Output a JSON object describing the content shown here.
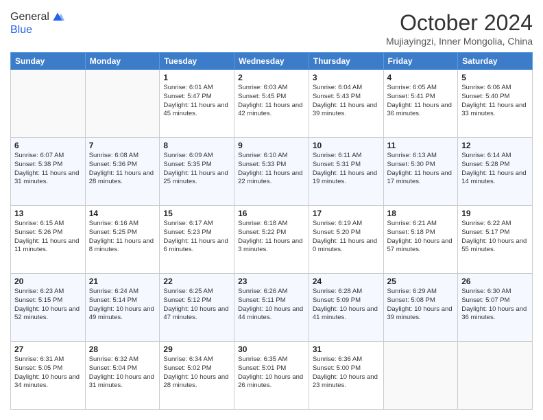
{
  "header": {
    "logo_line1": "General",
    "logo_line2": "Blue",
    "title": "October 2024",
    "subtitle": "Mujiayingzi, Inner Mongolia, China"
  },
  "weekdays": [
    "Sunday",
    "Monday",
    "Tuesday",
    "Wednesday",
    "Thursday",
    "Friday",
    "Saturday"
  ],
  "weeks": [
    [
      {
        "day": "",
        "info": ""
      },
      {
        "day": "",
        "info": ""
      },
      {
        "day": "1",
        "info": "Sunrise: 6:01 AM\nSunset: 5:47 PM\nDaylight: 11 hours and 45 minutes."
      },
      {
        "day": "2",
        "info": "Sunrise: 6:03 AM\nSunset: 5:45 PM\nDaylight: 11 hours and 42 minutes."
      },
      {
        "day": "3",
        "info": "Sunrise: 6:04 AM\nSunset: 5:43 PM\nDaylight: 11 hours and 39 minutes."
      },
      {
        "day": "4",
        "info": "Sunrise: 6:05 AM\nSunset: 5:41 PM\nDaylight: 11 hours and 36 minutes."
      },
      {
        "day": "5",
        "info": "Sunrise: 6:06 AM\nSunset: 5:40 PM\nDaylight: 11 hours and 33 minutes."
      }
    ],
    [
      {
        "day": "6",
        "info": "Sunrise: 6:07 AM\nSunset: 5:38 PM\nDaylight: 11 hours and 31 minutes."
      },
      {
        "day": "7",
        "info": "Sunrise: 6:08 AM\nSunset: 5:36 PM\nDaylight: 11 hours and 28 minutes."
      },
      {
        "day": "8",
        "info": "Sunrise: 6:09 AM\nSunset: 5:35 PM\nDaylight: 11 hours and 25 minutes."
      },
      {
        "day": "9",
        "info": "Sunrise: 6:10 AM\nSunset: 5:33 PM\nDaylight: 11 hours and 22 minutes."
      },
      {
        "day": "10",
        "info": "Sunrise: 6:11 AM\nSunset: 5:31 PM\nDaylight: 11 hours and 19 minutes."
      },
      {
        "day": "11",
        "info": "Sunrise: 6:13 AM\nSunset: 5:30 PM\nDaylight: 11 hours and 17 minutes."
      },
      {
        "day": "12",
        "info": "Sunrise: 6:14 AM\nSunset: 5:28 PM\nDaylight: 11 hours and 14 minutes."
      }
    ],
    [
      {
        "day": "13",
        "info": "Sunrise: 6:15 AM\nSunset: 5:26 PM\nDaylight: 11 hours and 11 minutes."
      },
      {
        "day": "14",
        "info": "Sunrise: 6:16 AM\nSunset: 5:25 PM\nDaylight: 11 hours and 8 minutes."
      },
      {
        "day": "15",
        "info": "Sunrise: 6:17 AM\nSunset: 5:23 PM\nDaylight: 11 hours and 6 minutes."
      },
      {
        "day": "16",
        "info": "Sunrise: 6:18 AM\nSunset: 5:22 PM\nDaylight: 11 hours and 3 minutes."
      },
      {
        "day": "17",
        "info": "Sunrise: 6:19 AM\nSunset: 5:20 PM\nDaylight: 11 hours and 0 minutes."
      },
      {
        "day": "18",
        "info": "Sunrise: 6:21 AM\nSunset: 5:18 PM\nDaylight: 10 hours and 57 minutes."
      },
      {
        "day": "19",
        "info": "Sunrise: 6:22 AM\nSunset: 5:17 PM\nDaylight: 10 hours and 55 minutes."
      }
    ],
    [
      {
        "day": "20",
        "info": "Sunrise: 6:23 AM\nSunset: 5:15 PM\nDaylight: 10 hours and 52 minutes."
      },
      {
        "day": "21",
        "info": "Sunrise: 6:24 AM\nSunset: 5:14 PM\nDaylight: 10 hours and 49 minutes."
      },
      {
        "day": "22",
        "info": "Sunrise: 6:25 AM\nSunset: 5:12 PM\nDaylight: 10 hours and 47 minutes."
      },
      {
        "day": "23",
        "info": "Sunrise: 6:26 AM\nSunset: 5:11 PM\nDaylight: 10 hours and 44 minutes."
      },
      {
        "day": "24",
        "info": "Sunrise: 6:28 AM\nSunset: 5:09 PM\nDaylight: 10 hours and 41 minutes."
      },
      {
        "day": "25",
        "info": "Sunrise: 6:29 AM\nSunset: 5:08 PM\nDaylight: 10 hours and 39 minutes."
      },
      {
        "day": "26",
        "info": "Sunrise: 6:30 AM\nSunset: 5:07 PM\nDaylight: 10 hours and 36 minutes."
      }
    ],
    [
      {
        "day": "27",
        "info": "Sunrise: 6:31 AM\nSunset: 5:05 PM\nDaylight: 10 hours and 34 minutes."
      },
      {
        "day": "28",
        "info": "Sunrise: 6:32 AM\nSunset: 5:04 PM\nDaylight: 10 hours and 31 minutes."
      },
      {
        "day": "29",
        "info": "Sunrise: 6:34 AM\nSunset: 5:02 PM\nDaylight: 10 hours and 28 minutes."
      },
      {
        "day": "30",
        "info": "Sunrise: 6:35 AM\nSunset: 5:01 PM\nDaylight: 10 hours and 26 minutes."
      },
      {
        "day": "31",
        "info": "Sunrise: 6:36 AM\nSunset: 5:00 PM\nDaylight: 10 hours and 23 minutes."
      },
      {
        "day": "",
        "info": ""
      },
      {
        "day": "",
        "info": ""
      }
    ]
  ]
}
